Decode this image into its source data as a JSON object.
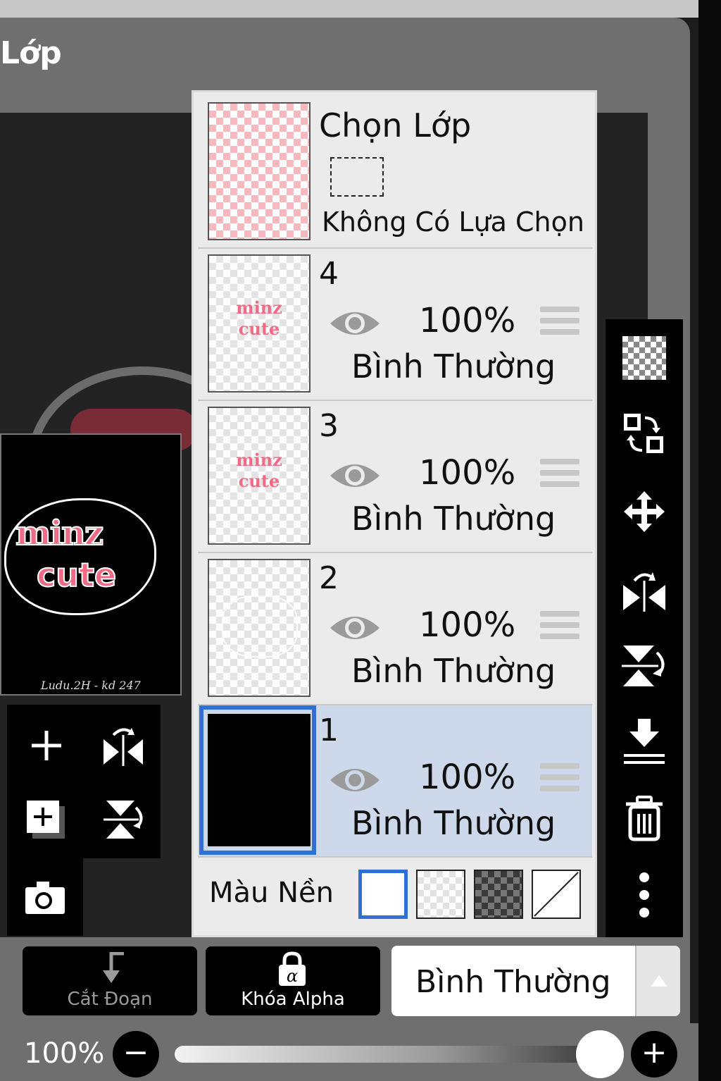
{
  "panel": {
    "title": "Lớp"
  },
  "preview": {
    "word1": "minz",
    "word2": "cute",
    "signature": "Ludu.2H - kd 247"
  },
  "selection_row": {
    "title": "Chọn Lớp",
    "status": "Không Có Lựa Chọn"
  },
  "layers": [
    {
      "number": "4",
      "opacity": "100%",
      "blend": "Bình Thường",
      "thumb_text_1": "minz",
      "thumb_text_2": "cute",
      "selected": false
    },
    {
      "number": "3",
      "opacity": "100%",
      "blend": "Bình Thường",
      "thumb_text_1": "minz",
      "thumb_text_2": "cute",
      "selected": false
    },
    {
      "number": "2",
      "opacity": "100%",
      "blend": "Bình Thường",
      "selected": false
    },
    {
      "number": "1",
      "opacity": "100%",
      "blend": "Bình Thường",
      "selected": true
    }
  ],
  "background": {
    "label": "Màu Nền",
    "options": [
      "white",
      "checker-light",
      "checker-dark",
      "none"
    ],
    "selected": "white"
  },
  "right_toolbar": [
    "transparency-icon",
    "swap-layers-icon",
    "move-icon",
    "flip-horizontal-icon",
    "flip-vertical-icon",
    "merge-down-icon",
    "trash-icon",
    "more-icon"
  ],
  "left_toolbar": [
    "add-layer-icon",
    "flip-horizontal-icon",
    "add-copy-icon",
    "flip-vertical-icon",
    "camera-icon"
  ],
  "bottom": {
    "clip_label": "Cắt Đoạn",
    "alpha_lock_label": "Khóa Alpha",
    "blend_mode": "Bình Thường"
  },
  "opacity_slider": {
    "label": "100%",
    "value": 1.0
  },
  "colors": {
    "selected_layer_bg": "#cdd9ea",
    "selection_border": "#2f6fd6",
    "accent_pink": "#f06b86"
  }
}
